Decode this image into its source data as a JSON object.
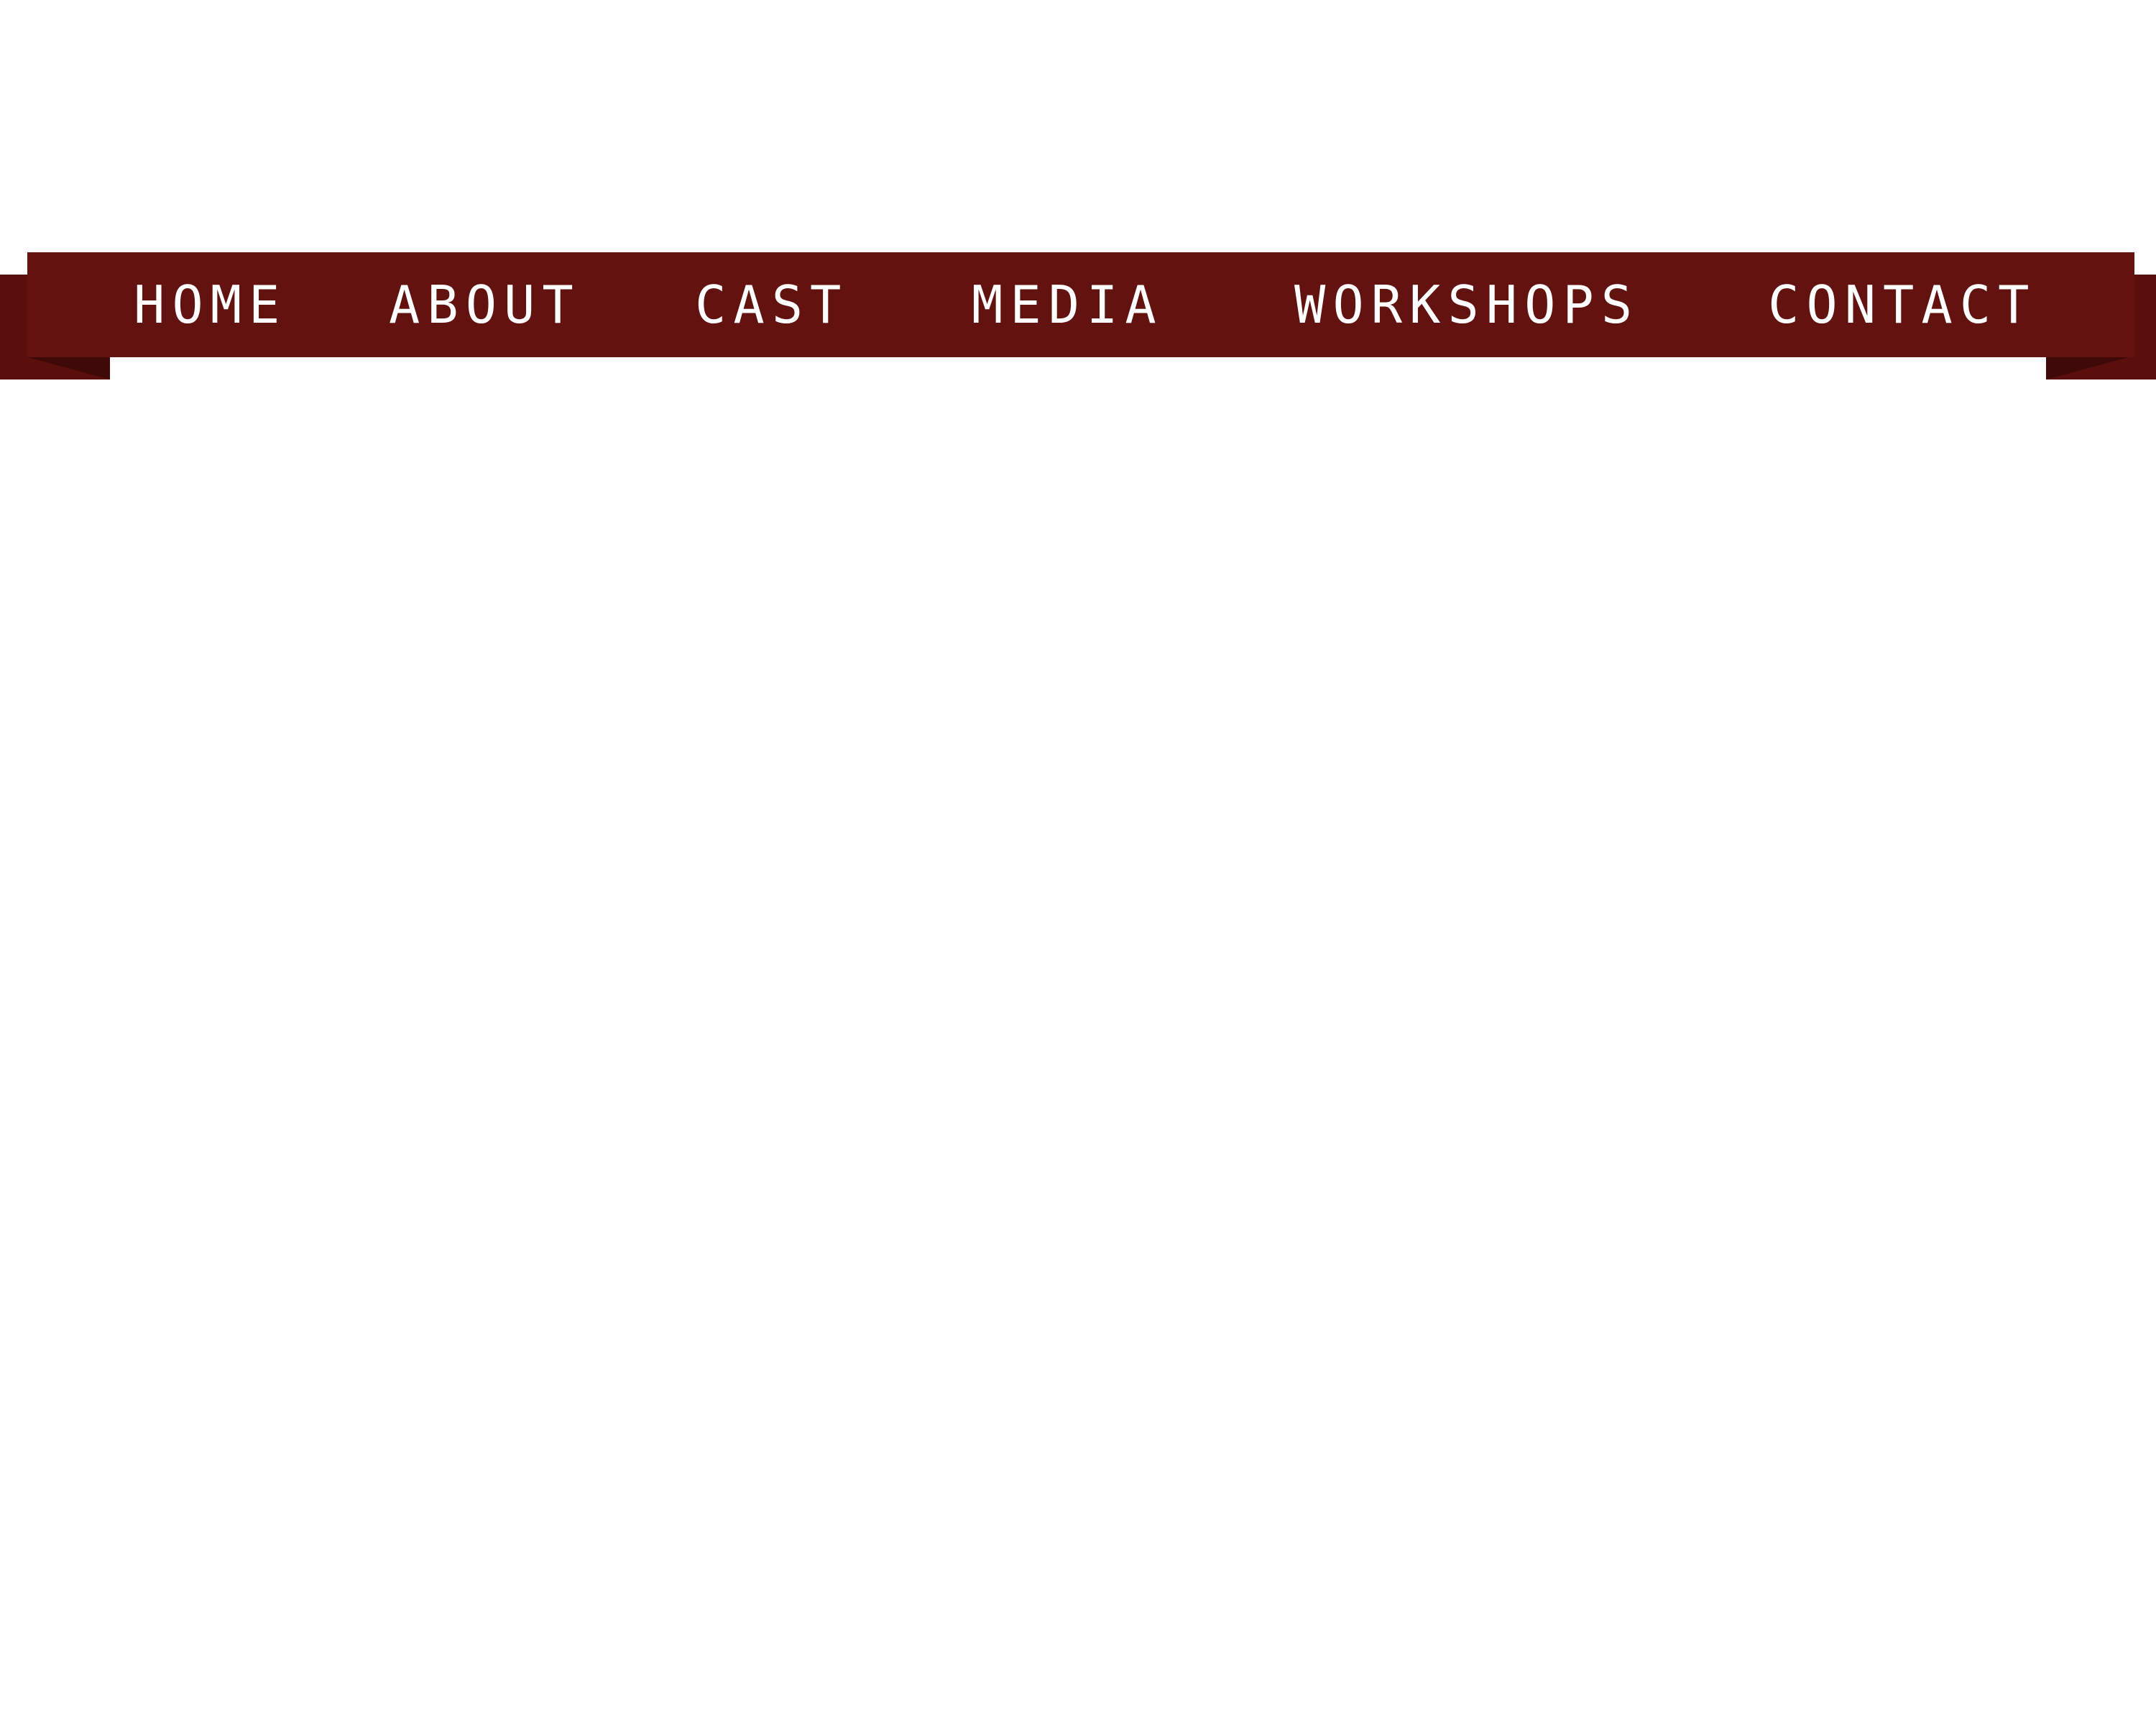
{
  "nav": {
    "items": [
      {
        "label": "HOME"
      },
      {
        "label": "ABOUT"
      },
      {
        "label": "CAST"
      },
      {
        "label": "MEDIA"
      },
      {
        "label": "WORKSHOPS"
      },
      {
        "label": "CONTACT"
      }
    ]
  },
  "colors": {
    "ribbon": "#621310",
    "ribbon_tail": "#5a0f0d",
    "text": "#ffffff",
    "background": "#ffffff"
  }
}
